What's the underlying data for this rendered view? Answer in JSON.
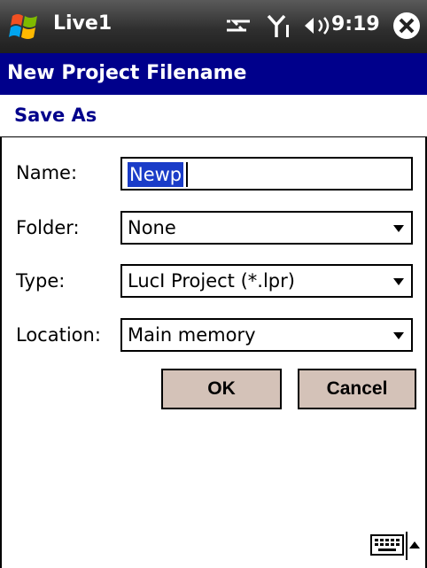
{
  "statusbar": {
    "app_title": "Live1",
    "time": "9:19"
  },
  "dialog": {
    "title": "New Project Filename",
    "subtitle": "Save As"
  },
  "form": {
    "name_label": "Name:",
    "name_value": "Newp",
    "folder_label": "Folder:",
    "folder_value": "None",
    "type_label": "Type:",
    "type_value": "LucI Project (*.lpr)",
    "location_label": "Location:",
    "location_value": "Main memory"
  },
  "buttons": {
    "ok": "OK",
    "cancel": "Cancel"
  },
  "colors": {
    "title_bar": "#00008b",
    "button": "#d4c2b8",
    "selection": "#1a3cc8"
  }
}
